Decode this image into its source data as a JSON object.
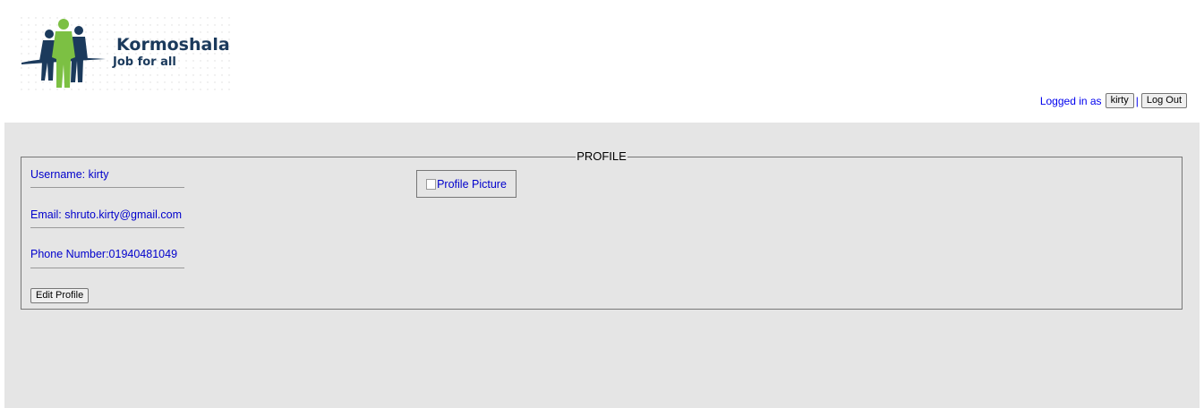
{
  "logo": {
    "title": "Kormoshala",
    "tagline": "Job for all",
    "colors": {
      "navy": "#1b3a5c",
      "green": "#7cc043"
    }
  },
  "header": {
    "logged_in_text": "Logged in as",
    "username_button": "kirty",
    "separator": "|",
    "logout_button": "Log Out"
  },
  "profile": {
    "legend": "PROFILE",
    "username_label": "Username: kirty",
    "email_label": "Email: shruto.kirty@gmail.com",
    "phone_label": "Phone Number:01940481049",
    "picture_alt": "Profile Picture",
    "edit_button": "Edit Profile"
  },
  "colors": {
    "link": "#0000cc",
    "panel_bg": "#e5e5e5"
  }
}
